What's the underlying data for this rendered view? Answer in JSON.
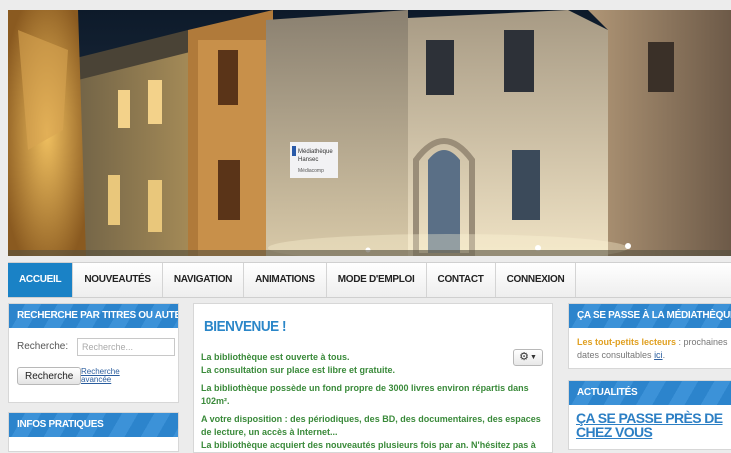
{
  "hero": {
    "sign_line1": "Médiathèque",
    "sign_line2": "Hansec",
    "sign_line3": "Médiacomp"
  },
  "nav": {
    "items": [
      {
        "label": "ACCUEIL"
      },
      {
        "label": "NOUVEAUTÉS"
      },
      {
        "label": "NAVIGATION"
      },
      {
        "label": "ANIMATIONS"
      },
      {
        "label": "MODE D'EMPLOI"
      },
      {
        "label": "CONTACT"
      },
      {
        "label": "CONNEXION"
      }
    ]
  },
  "search": {
    "title": "RECHERCHE PAR TITRES OU AUTEURS",
    "label": "Recherche:",
    "placeholder": "Recherche...",
    "button": "Recherche",
    "advanced_line1": "Recherche",
    "advanced_line2": "avancée"
  },
  "infos": {
    "title": "INFOS PRATIQUES"
  },
  "main": {
    "title": "BIENVENUE !",
    "line1": "La bibliothèque est ouverte à tous.",
    "line2": "La consultation sur place est libre et gratuite.",
    "para2": "La bibliothèque possède un fond propre de 3000 livres environ répartis dans 102m².",
    "para3": "A votre disposition : des périodiques, des BD, des documentaires, des espaces de lecture, un accès à Internet...",
    "para4": "La bibliothèque acquiert des nouveautés plusieurs fois par an. N'hésitez pas à"
  },
  "events": {
    "title": "ÇA SE PASSE À LA MÉDIATHÈQUE",
    "strong": "Les tout-petits lecteurs",
    "text": " : prochaines dates consultables ",
    "link": "ici",
    "end": "."
  },
  "news": {
    "title": "ACTUALITÉS",
    "headline": "ÇA SE PASSE PRÈS DE CHEZ VOUS"
  }
}
